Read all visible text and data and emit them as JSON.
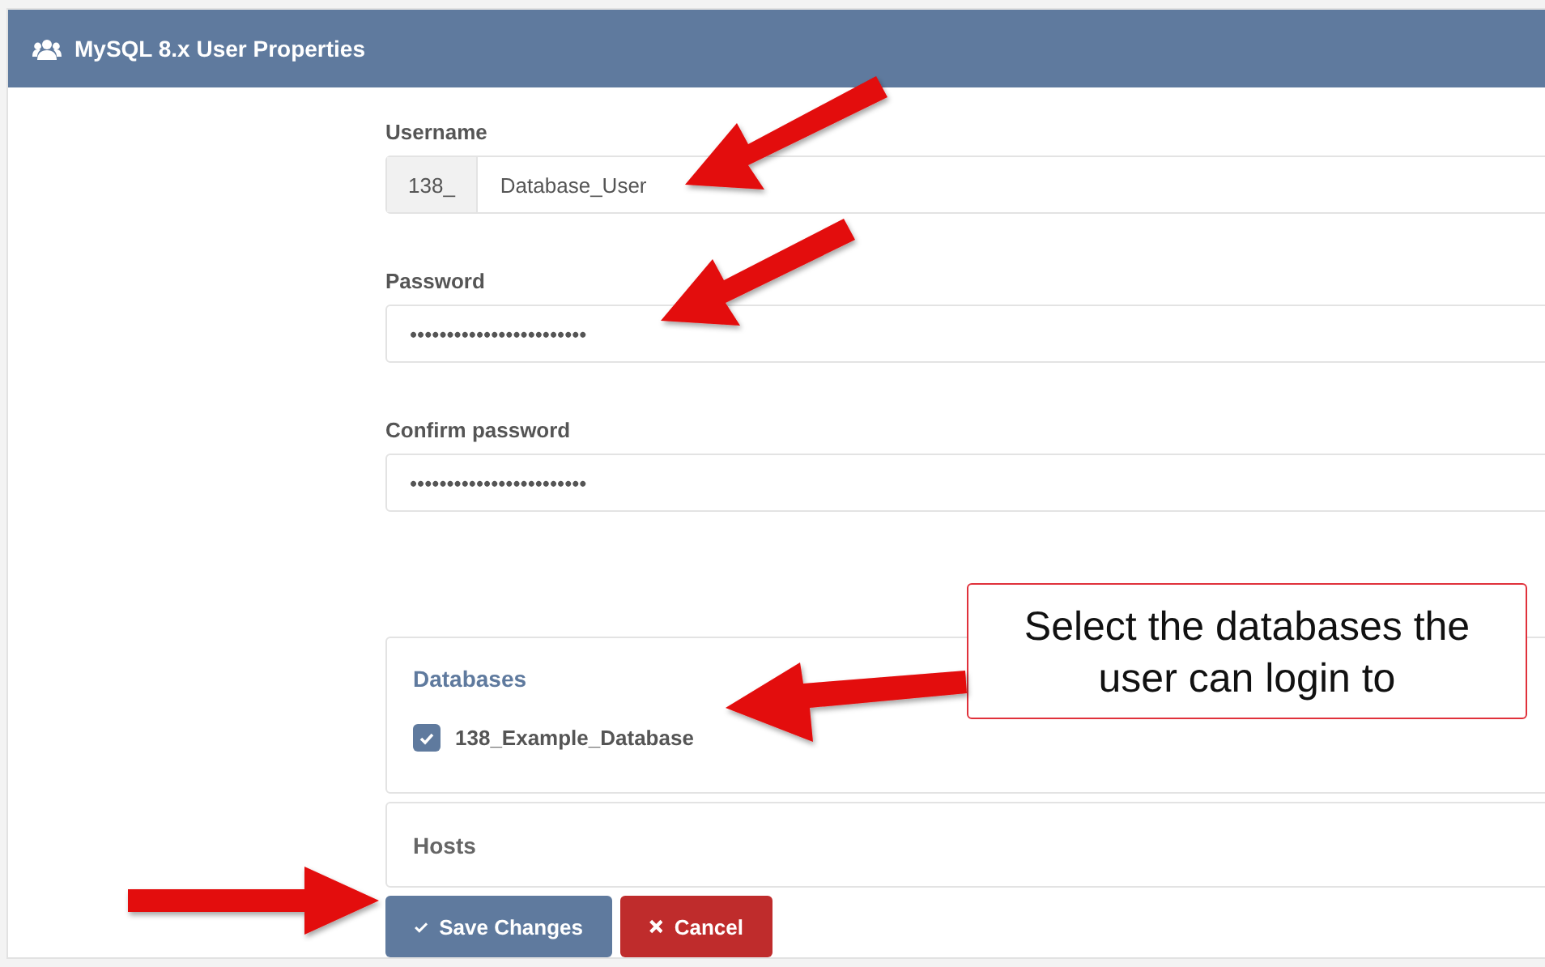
{
  "panel": {
    "title": "MySQL 8.x User Properties"
  },
  "username": {
    "label": "Username",
    "prefix": "138_",
    "value": "Database_User"
  },
  "password": {
    "label": "Password",
    "value": "••••••••••••••••••••••••"
  },
  "confirm_password": {
    "label": "Confirm password",
    "value": "••••••••••••••••••••••••"
  },
  "databases": {
    "title": "Databases",
    "items": [
      {
        "label": "138_Example_Database",
        "checked": true
      }
    ]
  },
  "hosts": {
    "title": "Hosts"
  },
  "buttons": [
    {
      "kind": "save",
      "label": "Save Changes"
    },
    {
      "kind": "cancel",
      "label": "Cancel"
    }
  ],
  "callout": "Select the databases the user can login to"
}
